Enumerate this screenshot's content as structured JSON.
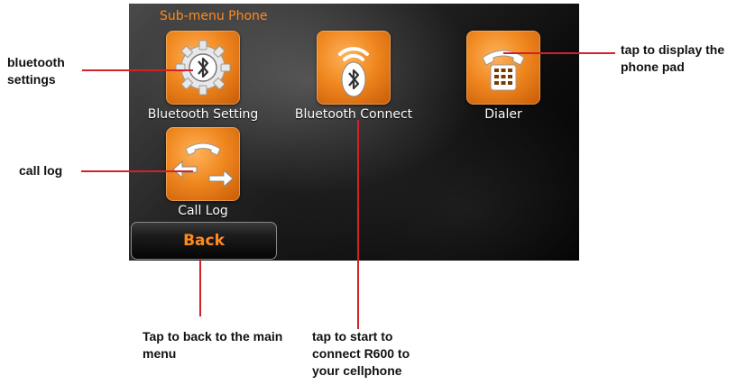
{
  "screen": {
    "title": "Sub-menu Phone",
    "apps": [
      {
        "label": "Bluetooth Setting",
        "icon": "bluetooth-gear-icon"
      },
      {
        "label": "Bluetooth Connect",
        "icon": "bluetooth-connect-icon"
      },
      {
        "label": "Dialer",
        "icon": "phone-keypad-icon"
      },
      {
        "label": "Call Log",
        "icon": "call-log-icon"
      }
    ],
    "back_label": "Back"
  },
  "callouts": {
    "bluetooth_settings": "bluetooth settings",
    "call_log": "call log",
    "dialer": "tap to display the phone pad",
    "back": "Tap to back to the main menu",
    "bluetooth_connect": "tap to start to connect R600 to your cellphone"
  },
  "colors": {
    "accent": "#ff8a1f",
    "tile": "#f08820",
    "leader_line": "#d0222a"
  }
}
